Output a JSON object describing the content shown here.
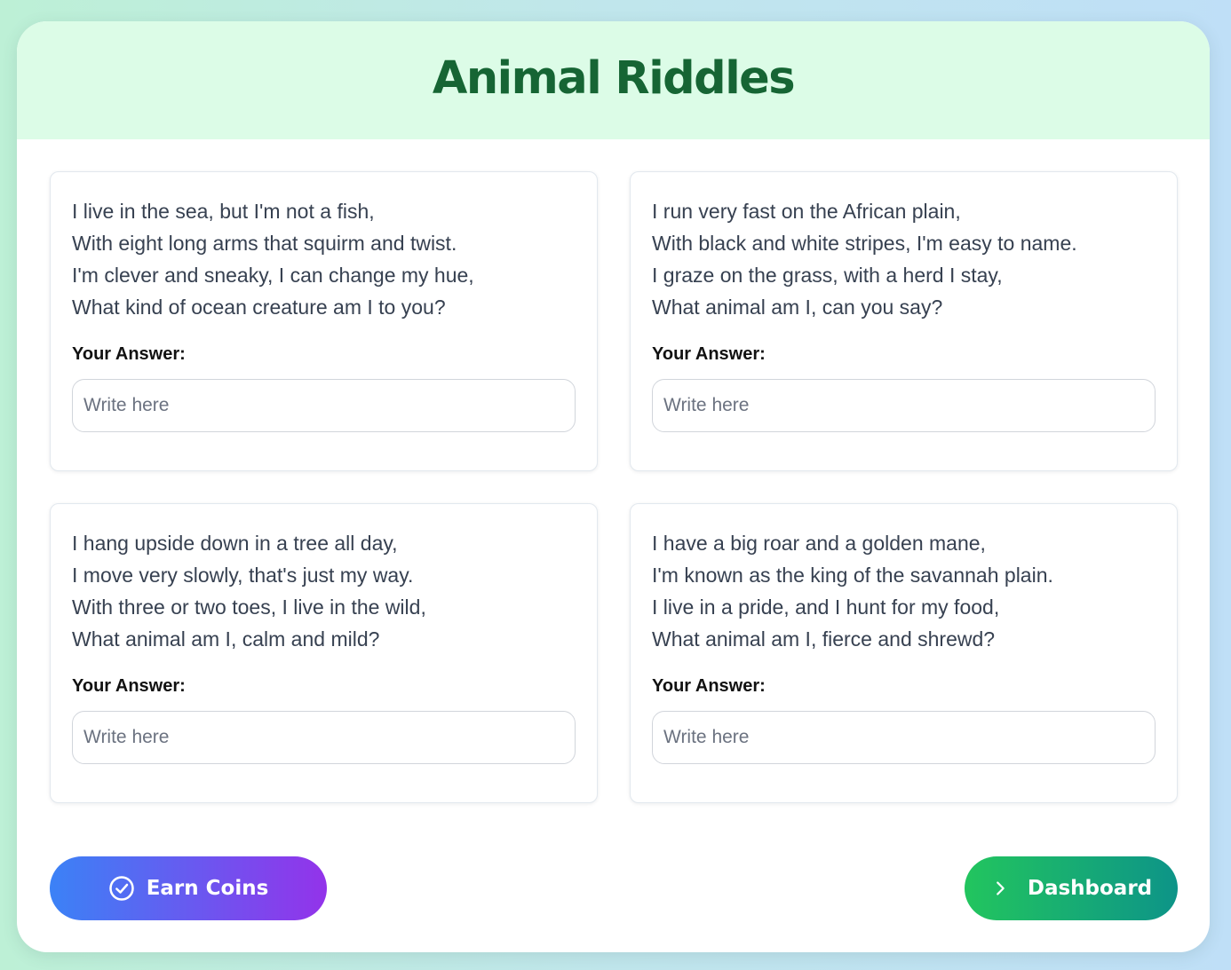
{
  "header": {
    "title": "Animal Riddles"
  },
  "riddles": [
    {
      "lines": [
        "I live in the sea, but I'm not a fish,",
        "With eight long arms that squirm and twist.",
        "I'm clever and sneaky, I can change my hue,",
        "What kind of ocean creature am I to you?"
      ],
      "answer_label": "Your Answer:",
      "answer_placeholder": "Write here",
      "answer_value": ""
    },
    {
      "lines": [
        "I run very fast on the African plain,",
        "With black and white stripes, I'm easy to name.",
        "I graze on the grass, with a herd I stay,",
        "What animal am I, can you say?"
      ],
      "answer_label": "Your Answer:",
      "answer_placeholder": "Write here",
      "answer_value": ""
    },
    {
      "lines": [
        "I hang upside down in a tree all day,",
        "I move very slowly, that's just my way.",
        "With three or two toes, I live in the wild,",
        "What animal am I, calm and mild?"
      ],
      "answer_label": "Your Answer:",
      "answer_placeholder": "Write here",
      "answer_value": ""
    },
    {
      "lines": [
        "I have a big roar and a golden mane,",
        "I'm known as the king of the savannah plain.",
        "I live in a pride, and I hunt for my food,",
        "What animal am I, fierce and shrewd?"
      ],
      "answer_label": "Your Answer:",
      "answer_placeholder": "Write here",
      "answer_value": ""
    }
  ],
  "actions": {
    "earn_coins": {
      "label": "Earn Coins",
      "icon": "check-circle-icon"
    },
    "dashboard": {
      "label": "Dashboard",
      "icon": "chevron-right-icon"
    }
  },
  "colors": {
    "header_bg": "#dcfce7",
    "title": "#166534",
    "earn_gradient": [
      "#3b82f6",
      "#9333ea"
    ],
    "dashboard_gradient": [
      "#22c55e",
      "#0d9488"
    ]
  }
}
